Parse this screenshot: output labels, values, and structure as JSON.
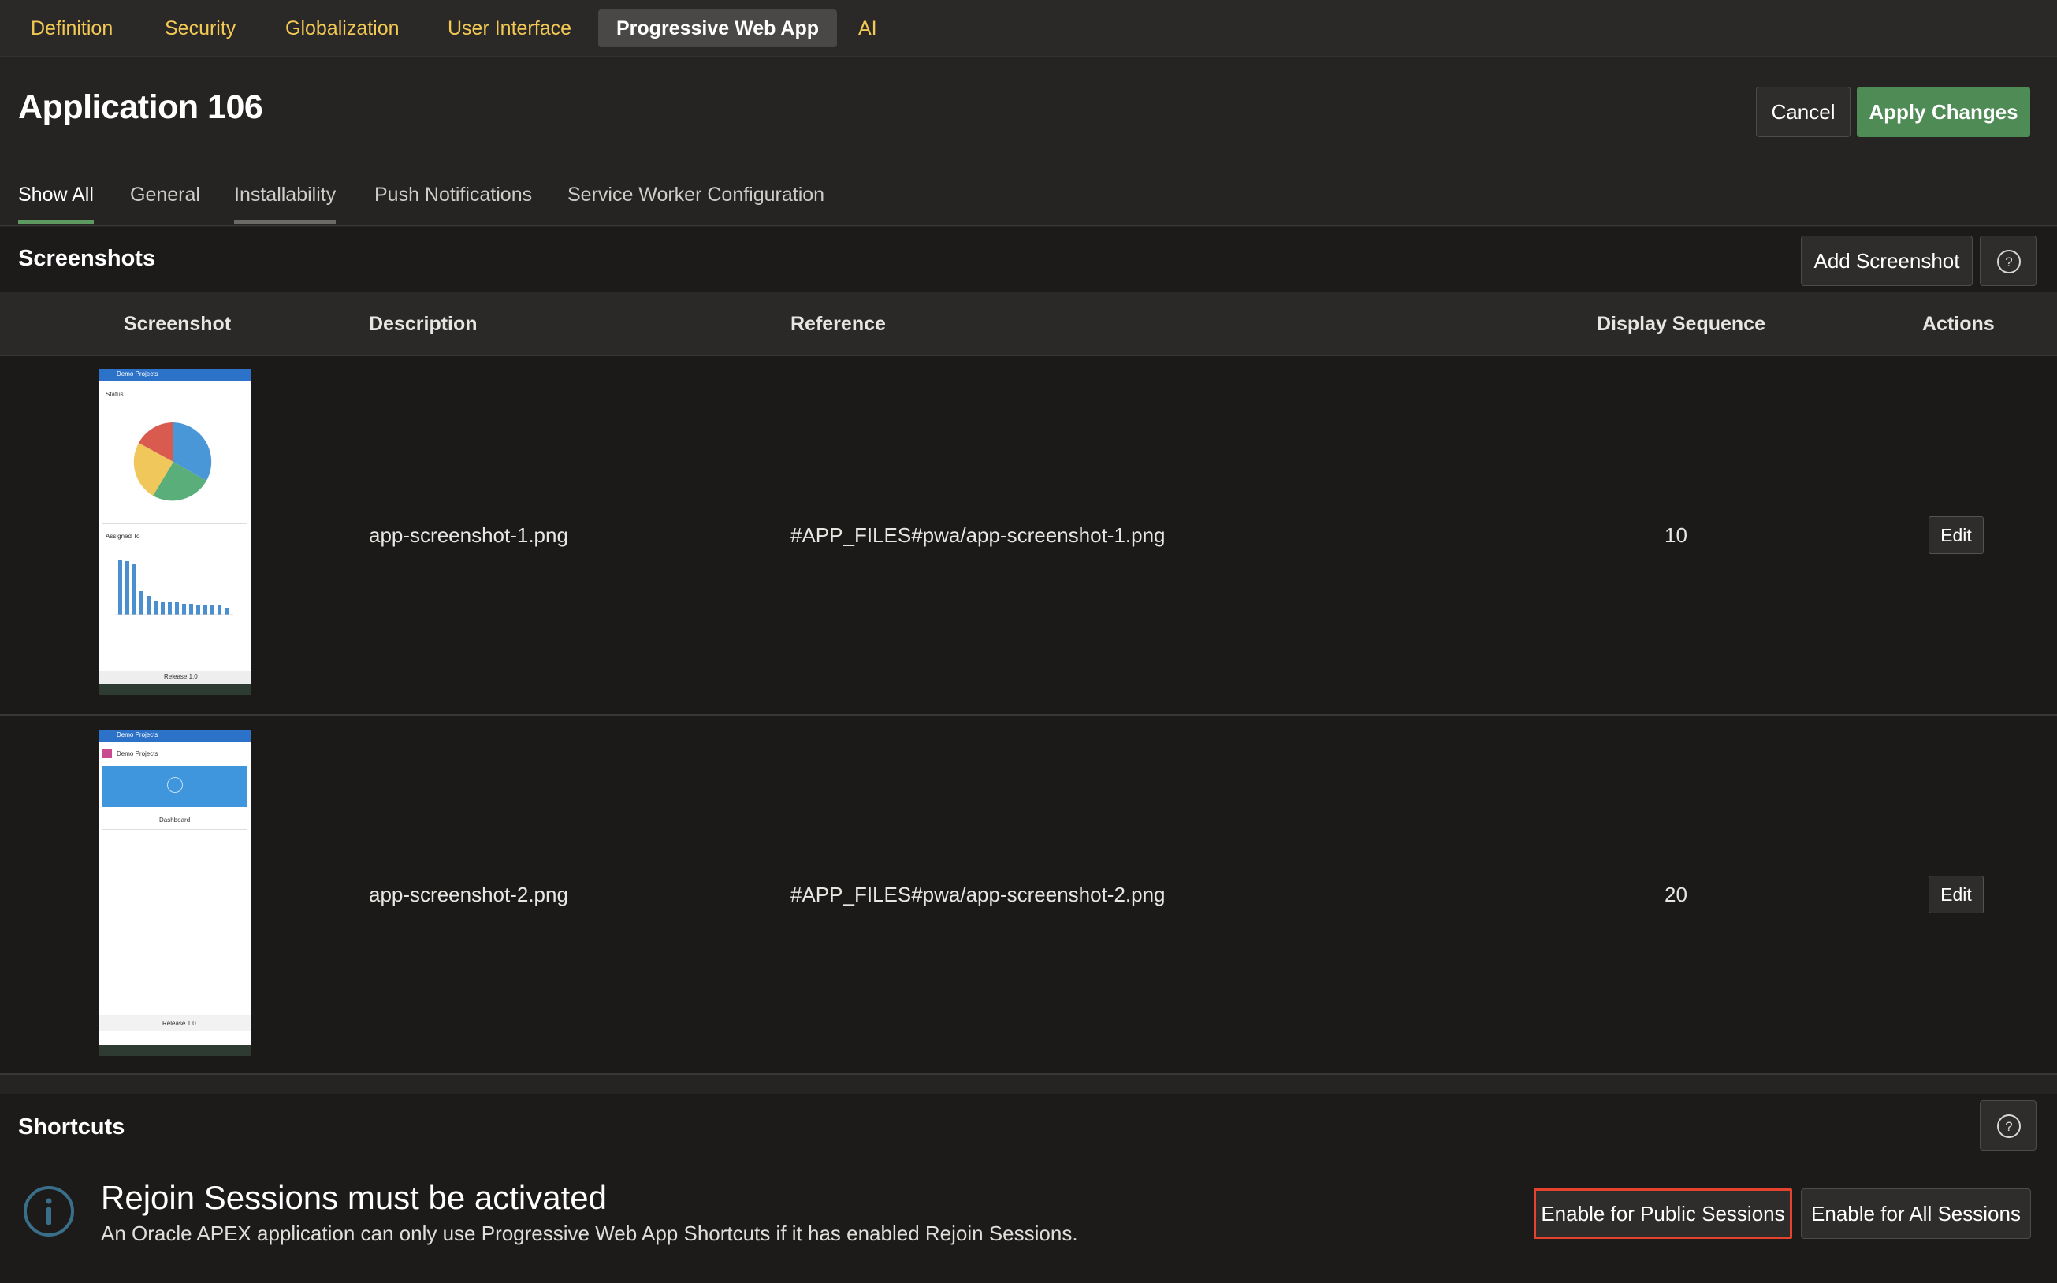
{
  "topnav": {
    "tabs": [
      {
        "label": "Definition"
      },
      {
        "label": "Security"
      },
      {
        "label": "Globalization"
      },
      {
        "label": "User Interface"
      },
      {
        "label": "Progressive Web App",
        "active": true
      },
      {
        "label": "AI"
      }
    ]
  },
  "header": {
    "title": "Application 106",
    "cancel_label": "Cancel",
    "apply_label": "Apply Changes"
  },
  "subtabs": [
    {
      "label": "Show All",
      "active": true
    },
    {
      "label": "General"
    },
    {
      "label": "Installability"
    },
    {
      "label": "Push Notifications"
    },
    {
      "label": "Service Worker Configuration"
    }
  ],
  "screenshots": {
    "title": "Screenshots",
    "add_label": "Add Screenshot",
    "columns": [
      "Screenshot",
      "Description",
      "Reference",
      "Display Sequence",
      "Actions"
    ],
    "rows": [
      {
        "description": "app-screenshot-1.png",
        "reference": "#APP_FILES#pwa/app-screenshot-1.png",
        "sequence": "10",
        "action": "Edit",
        "thumb_app": "Demo Projects",
        "thumb_status": "Status",
        "thumb_assigned": "Assigned To",
        "thumb_release": "Release 1.0"
      },
      {
        "description": "app-screenshot-2.png",
        "reference": "#APP_FILES#pwa/app-screenshot-2.png",
        "sequence": "20",
        "action": "Edit",
        "thumb_app": "Demo Projects",
        "thumb_home": "Demo Projects",
        "thumb_dashboard": "Dashboard",
        "thumb_release": "Release 1.0"
      }
    ]
  },
  "shortcuts": {
    "title": "Shortcuts",
    "alert_title": "Rejoin Sessions must be activated",
    "alert_text": "An Oracle APEX application can only use Progressive Web App Shortcuts if it has enabled Rejoin Sessions.",
    "public_label": "Enable for Public Sessions",
    "all_label": "Enable for All Sessions"
  },
  "colors": {
    "accent_green": "#4f8b54",
    "nav_link": "#f3c955",
    "highlight_red": "#e5432e"
  },
  "icons": [
    "help-icon",
    "info-icon"
  ]
}
